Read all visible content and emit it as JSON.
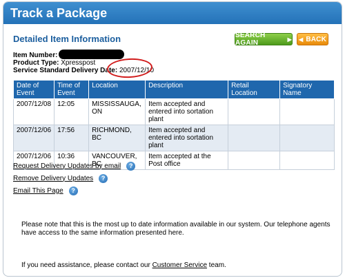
{
  "header": {
    "title": "Track a Package"
  },
  "section": {
    "title": "Detailed Item Information"
  },
  "buttons": {
    "search_again": "SEARCH AGAIN",
    "back": "BACK"
  },
  "info": {
    "item_number_label": "Item Number:",
    "product_type_label": "Product Type:",
    "product_type_value": "Xpresspost",
    "delivery_date_label": "Service Standard Delivery Date:",
    "delivery_date_value": "2007/12/10"
  },
  "table": {
    "headers": [
      "Date of Event",
      "Time of Event",
      "Location",
      "Description",
      "Retail Location",
      "Signatory Name"
    ],
    "rows": [
      [
        "2007/12/08",
        "12:05",
        "MISSISSAUGA, ON",
        "Item accepted and entered into sortation plant",
        "",
        ""
      ],
      [
        "2007/12/06",
        "17:56",
        "RICHMOND, BC",
        "Item accepted and entered into sortation plant",
        "",
        ""
      ],
      [
        "2007/12/06",
        "10:36",
        "VANCOUVER, BC",
        "Item accepted at the Post office",
        "",
        ""
      ]
    ]
  },
  "links": {
    "request_updates": "Request Delivery Updates by email",
    "remove_updates": "Remove Delivery Updates",
    "email_page": "Email This Page",
    "help_glyph": "?"
  },
  "note": "Please note that this is the most up to date information available in our system. Our telephone agents have access to the same information presented here.",
  "assist": {
    "prefix": "If you need assistance, please contact our ",
    "link": "Customer Service",
    "suffix": " team."
  }
}
